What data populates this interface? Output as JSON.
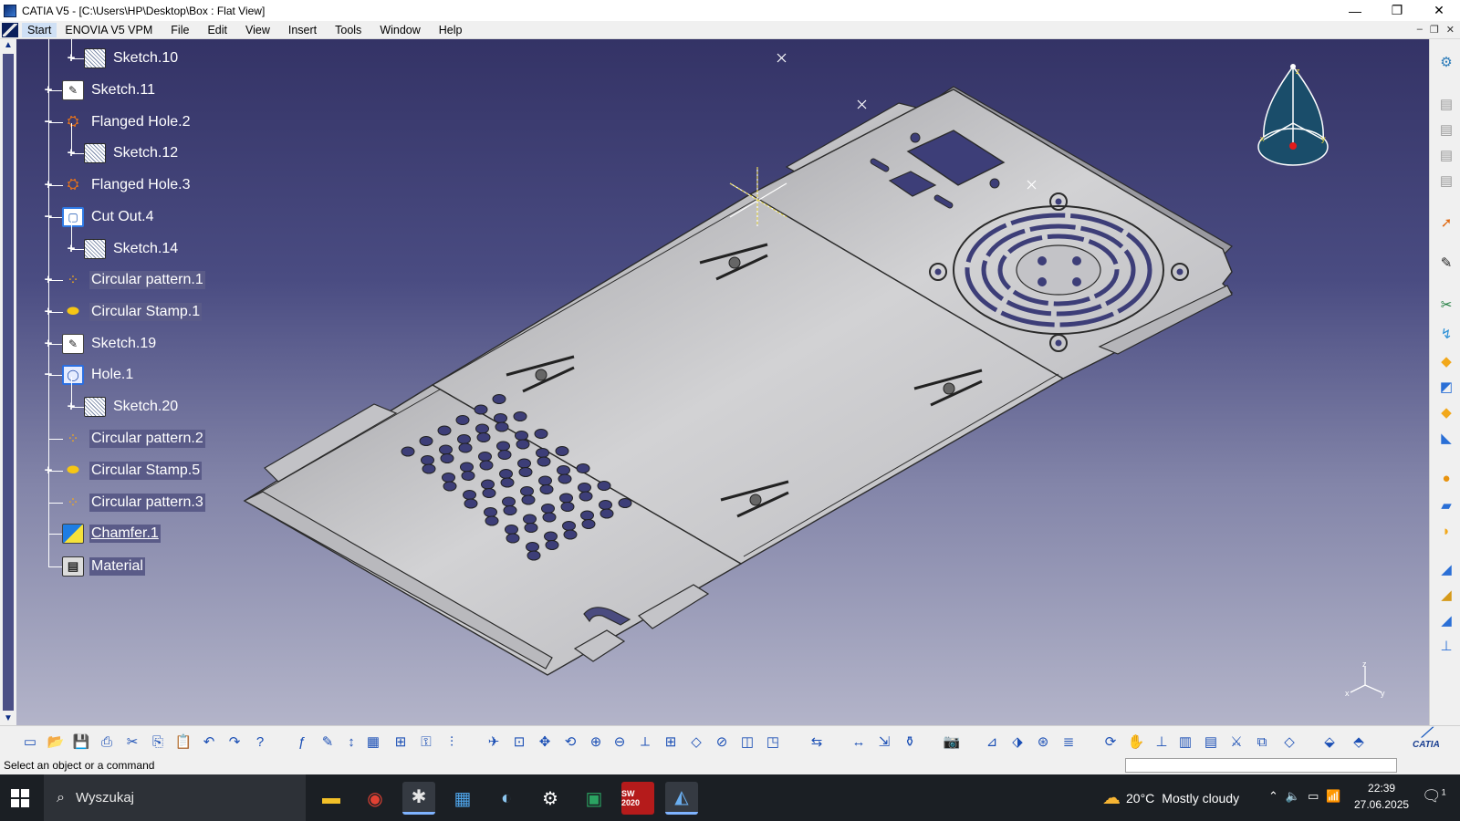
{
  "window": {
    "title": "CATIA V5 - [C:\\Users\\HP\\Desktop\\Box : Flat View]",
    "minimize": "—",
    "maximize": "❐",
    "close": "✕"
  },
  "menu": {
    "items": [
      "Start",
      "ENOVIA V5 VPM",
      "File",
      "Edit",
      "View",
      "Insert",
      "Tools",
      "Window",
      "Help"
    ]
  },
  "tree": {
    "nodes": [
      {
        "label": "Sketch.10",
        "icon": "sketch-icon",
        "expanded": false
      },
      {
        "label": "Sketch.11",
        "icon": "sketch-pencil-icon",
        "expanded": false
      },
      {
        "label": "Flanged Hole.2",
        "icon": "flanged-hole-icon",
        "expanded": true
      },
      {
        "label": "Sketch.12",
        "icon": "sketch-icon",
        "expanded": false
      },
      {
        "label": "Flanged Hole.3",
        "icon": "flanged-hole-icon",
        "expanded": false
      },
      {
        "label": "Cut Out.4",
        "icon": "cut-out-icon",
        "expanded": true
      },
      {
        "label": "Sketch.14",
        "icon": "sketch-icon",
        "expanded": false
      },
      {
        "label": "Circular pattern.1",
        "icon": "circular-pattern-icon",
        "expanded": false
      },
      {
        "label": "Circular Stamp.1",
        "icon": "circular-stamp-icon",
        "expanded": false
      },
      {
        "label": "Sketch.19",
        "icon": "sketch-pencil-icon",
        "expanded": false
      },
      {
        "label": "Hole.1",
        "icon": "hole-icon",
        "expanded": true
      },
      {
        "label": "Sketch.20",
        "icon": "sketch-icon",
        "expanded": false
      },
      {
        "label": "Circular pattern.2",
        "icon": "circular-pattern-icon",
        "expanded": null
      },
      {
        "label": "Circular Stamp.5",
        "icon": "circular-stamp-icon",
        "expanded": false
      },
      {
        "label": "Circular pattern.3",
        "icon": "circular-pattern-icon",
        "expanded": null
      },
      {
        "label": "Chamfer.1",
        "icon": "chamfer-icon",
        "expanded": null
      },
      {
        "label": "Material",
        "icon": "material-icon",
        "expanded": null
      }
    ]
  },
  "compass": {
    "x": "x",
    "y": "y",
    "z": "z"
  },
  "triad": {
    "x": "x",
    "y": "y",
    "z": "z"
  },
  "status": {
    "message": "Select an object or a command",
    "command_input": ""
  },
  "taskbar": {
    "search_placeholder": "Wyszukaj",
    "apps": [
      "file-explorer-icon",
      "chrome-icon",
      "paint-icon",
      "calculator-icon",
      "color-app-icon",
      "settings-icon",
      "excel-icon",
      "solidworks-icon",
      "catia-icon"
    ],
    "solidworks_label": "SW 2020",
    "weather_temp": "20°C",
    "weather_text": "Mostly cloudy",
    "time": "22:39",
    "date": "27.06.2025",
    "notifications": "1"
  },
  "colors": {
    "viewport_top": "#343366",
    "viewport_bottom": "#b3b4c9",
    "part_face": "#c9c9c9",
    "highlight": "#e5d33a"
  },
  "catia_brand": "CATIA"
}
